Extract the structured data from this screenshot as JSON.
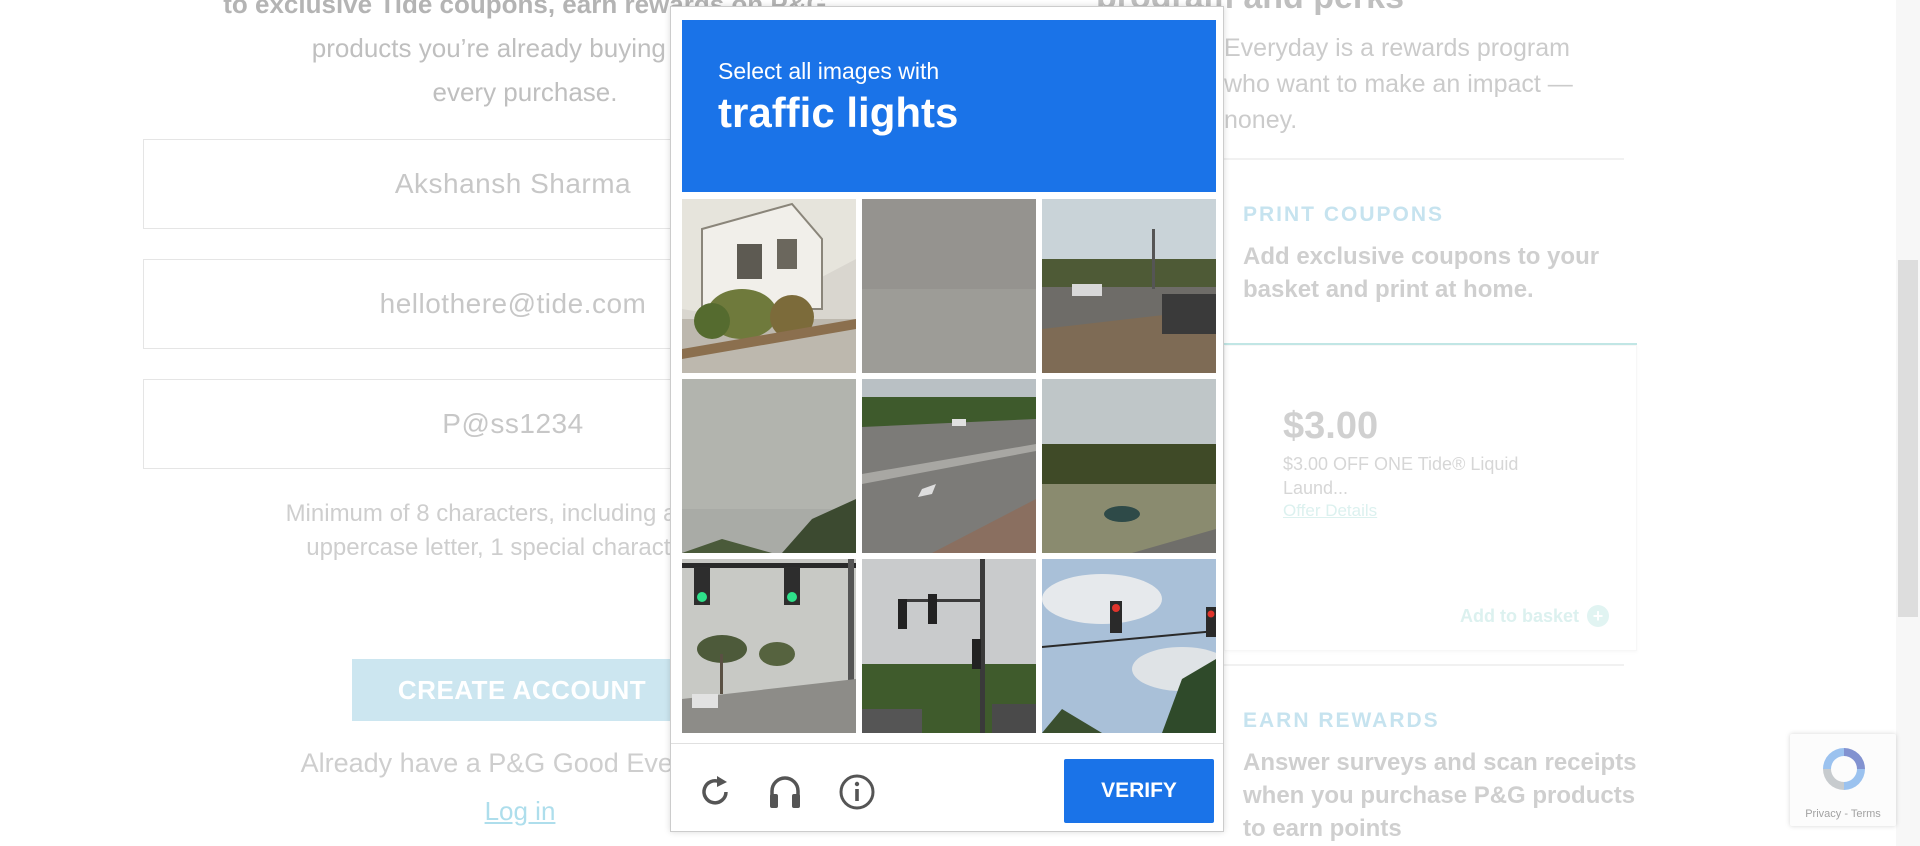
{
  "signup": {
    "intro_line0": "to exclusive Tide coupons, earn rewards on P&G",
    "intro_line1": "products you’re already buying and h",
    "intro_line2": "every purchase.",
    "name_value": "Akshansh Sharma",
    "email_value": "hellothere@tide.com",
    "password_value": "P@ss1234",
    "hint_line1": "Minimum of 8 characters, including at least",
    "hint_line2": "uppercase letter, 1 special character ar",
    "create_button": "CREATE ACCOUNT",
    "already_text": "Already have a P&G Good Everyda",
    "login_link": "Log in"
  },
  "perks": {
    "heading_fragment": "program and perks",
    "program_line1": "Everyday is a rewards program",
    "program_line2": "who want to make an impact —",
    "program_line3": "noney.",
    "print_title": "PRINT COUPONS",
    "print_text": "Add exclusive coupons to your basket and print at home.",
    "coupon_price": "$3.00",
    "coupon_desc": "$3.00 OFF ONE Tide® Liquid Laund...",
    "offer_details": "Offer Details",
    "add_to_basket": "Add to basket",
    "earn_title": "EARN REWARDS",
    "earn_text": "Answer surveys and scan receipts when you purchase P&G products to earn points"
  },
  "captcha": {
    "instruction": "Select all images with",
    "target": "traffic lights",
    "tiles": [
      {
        "label": "house with palm trees"
      },
      {
        "label": "gray noise"
      },
      {
        "label": "road with cars"
      },
      {
        "label": "cloudy sky"
      },
      {
        "label": "highway lanes"
      },
      {
        "label": "grass field with trees"
      },
      {
        "label": "traffic lights with palms"
      },
      {
        "label": "traffic lights on pole"
      },
      {
        "label": "traffic light with sky"
      }
    ],
    "reload_icon": "reload-icon",
    "audio_icon": "headphones-icon",
    "info_icon": "info-icon",
    "verify_button": "VERIFY",
    "accent_color": "#1a73e8"
  },
  "recaptcha_badge": {
    "links": "Privacy - Terms"
  }
}
